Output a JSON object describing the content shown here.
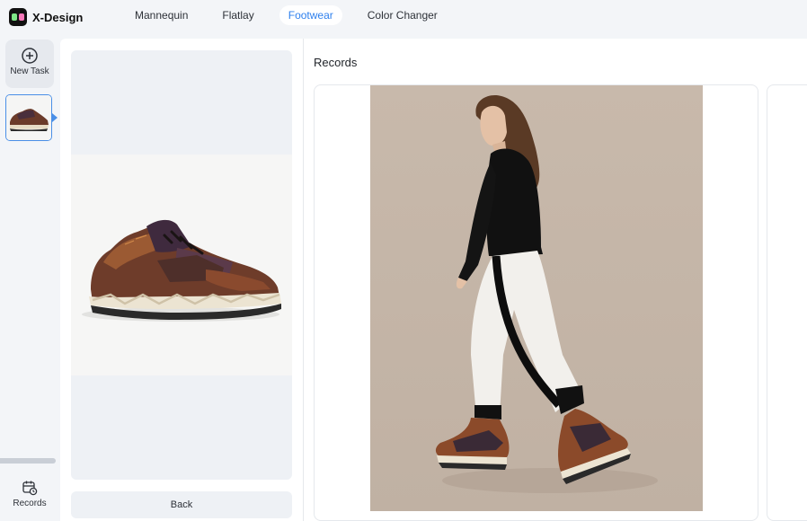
{
  "app": {
    "name": "X-Design"
  },
  "tabs": [
    {
      "label": "Mannequin",
      "active": false
    },
    {
      "label": "Flatlay",
      "active": false
    },
    {
      "label": "Footwear",
      "active": true
    },
    {
      "label": "Color Changer",
      "active": false
    }
  ],
  "sidebar": {
    "new_task_label": "New Task",
    "records_label": "Records"
  },
  "panel": {
    "back_label": "Back"
  },
  "records": {
    "title": "Records"
  },
  "colors": {
    "accent": "#2f80ed",
    "selection": "#4a8fe7",
    "background": "#f3f5f8"
  },
  "icons": [
    "plus-circle-icon",
    "calendar-clock-icon"
  ]
}
